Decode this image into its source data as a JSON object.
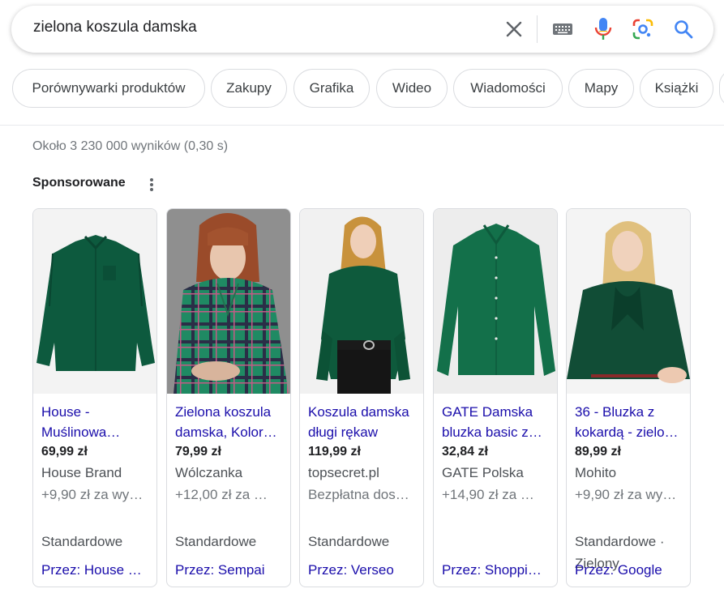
{
  "search": {
    "query": "zielona koszula damska"
  },
  "chips": [
    "Porównywarki produktów",
    "Zakupy",
    "Grafika",
    "Wideo",
    "Wiadomości",
    "Mapy",
    "Książki"
  ],
  "results_stats": "Około 3 230 000 wyników (0,30 s)",
  "sponsored_label": "Sponsorowane",
  "products": [
    {
      "title": "House - Muślinowa…",
      "price": "69,99 zł",
      "store": "House Brand",
      "shipping": "+9,90 zł za wy…",
      "delivery": "Standardowe",
      "seller": "Przez: House …"
    },
    {
      "title": "Zielona koszula damska, Kolor…",
      "price": "79,99 zł",
      "store": "Wólczanka",
      "shipping": "+12,00 zł za …",
      "delivery": "Standardowe",
      "seller": "Przez: Sempai"
    },
    {
      "title": "Koszula damska długi rękaw",
      "price": "119,99 zł",
      "store": "topsecret.pl",
      "shipping": "Bezpłatna dos…",
      "delivery": "Standardowe",
      "seller": "Przez: Verseo"
    },
    {
      "title": "GATE Damska bluzka basic z…",
      "price": "32,84 zł",
      "store": "GATE Polska",
      "shipping": "+14,90 zł za …",
      "delivery": "",
      "seller": "Przez: Shoppi…"
    },
    {
      "title": "36 - Bluzka z kokardą - zielo…",
      "price": "89,99 zł",
      "store": "Mohito",
      "shipping": "+9,90 zł za wy…",
      "delivery": "Standardowe ·",
      "delivery_line2": "Zielony",
      "seller": "Przez: Google"
    }
  ],
  "colors": {
    "link": "#1a0dab",
    "shirt_green": "#0e5a3c",
    "plaid_green": "#1f8a63"
  }
}
